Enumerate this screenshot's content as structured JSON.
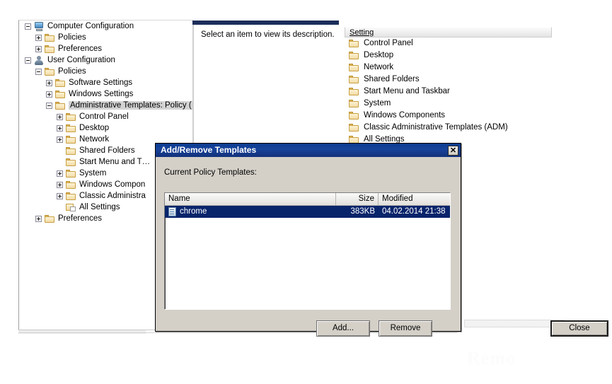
{
  "tree": {
    "items": [
      {
        "label": "Computer Configuration",
        "indent": 0,
        "expander": "minus",
        "icon": "computer-icon",
        "selected": false
      },
      {
        "label": "Policies",
        "indent": 1,
        "expander": "plus",
        "icon": "folder-icon",
        "selected": false
      },
      {
        "label": "Preferences",
        "indent": 1,
        "expander": "plus",
        "icon": "folder-icon",
        "selected": false
      },
      {
        "label": "User Configuration",
        "indent": 0,
        "expander": "minus",
        "icon": "user-icon",
        "selected": false
      },
      {
        "label": "Policies",
        "indent": 1,
        "expander": "minus",
        "icon": "folder-icon",
        "selected": false
      },
      {
        "label": "Software Settings",
        "indent": 2,
        "expander": "plus",
        "icon": "folder-icon",
        "selected": false
      },
      {
        "label": "Windows Settings",
        "indent": 2,
        "expander": "plus",
        "icon": "folder-icon",
        "selected": false
      },
      {
        "label": "Administrative Templates: Policy (",
        "indent": 2,
        "expander": "minus",
        "icon": "folder-icon",
        "selected": true
      },
      {
        "label": "Control Panel",
        "indent": 3,
        "expander": "plus",
        "icon": "folder-icon",
        "selected": false
      },
      {
        "label": "Desktop",
        "indent": 3,
        "expander": "plus",
        "icon": "folder-icon",
        "selected": false
      },
      {
        "label": "Network",
        "indent": 3,
        "expander": "plus",
        "icon": "folder-icon",
        "selected": false
      },
      {
        "label": "Shared Folders",
        "indent": 3,
        "expander": "none",
        "icon": "folder-icon",
        "selected": false
      },
      {
        "label": "Start Menu and T…",
        "indent": 3,
        "expander": "none",
        "icon": "folder-icon",
        "selected": false
      },
      {
        "label": "System",
        "indent": 3,
        "expander": "plus",
        "icon": "folder-icon",
        "selected": false
      },
      {
        "label": "Windows Compon",
        "indent": 3,
        "expander": "plus",
        "icon": "folder-icon",
        "selected": false
      },
      {
        "label": "Classic Administra",
        "indent": 3,
        "expander": "plus",
        "icon": "folder-icon",
        "selected": false
      },
      {
        "label": "All Settings",
        "indent": 3,
        "expander": "none",
        "icon": "all-settings-icon",
        "selected": false
      },
      {
        "label": "Preferences",
        "indent": 1,
        "expander": "plus",
        "icon": "folder-icon",
        "selected": false
      }
    ]
  },
  "description_pane": {
    "text": "Select an item to view its description."
  },
  "settings_pane": {
    "header": "Setting",
    "items": [
      {
        "label": "Control Panel"
      },
      {
        "label": "Desktop"
      },
      {
        "label": "Network"
      },
      {
        "label": "Shared Folders"
      },
      {
        "label": "Start Menu and Taskbar"
      },
      {
        "label": "System"
      },
      {
        "label": "Windows Components"
      },
      {
        "label": "Classic Administrative Templates (ADM)"
      },
      {
        "label": "All Settings"
      }
    ]
  },
  "dialog": {
    "title": "Add/Remove Templates",
    "close_glyph": "✕",
    "section_label": "Current Policy Templates:",
    "columns": {
      "name": "Name",
      "size": "Size",
      "modified": "Modified"
    },
    "rows": [
      {
        "name": "chrome",
        "size": "383KB",
        "modified": "04.02.2014 21:38",
        "selected": true
      }
    ],
    "buttons": {
      "add": "Add...",
      "remove": "Remove",
      "close": "Close"
    }
  },
  "watermark": {
    "text": "Remo"
  },
  "colors": {
    "dialog_face": "#d4d0c8",
    "title_blue": "#17439b",
    "selection_blue": "#08246b",
    "tree_selection_gray": "#d3d3d3",
    "desc_titlebar": "#1c2e5a"
  }
}
